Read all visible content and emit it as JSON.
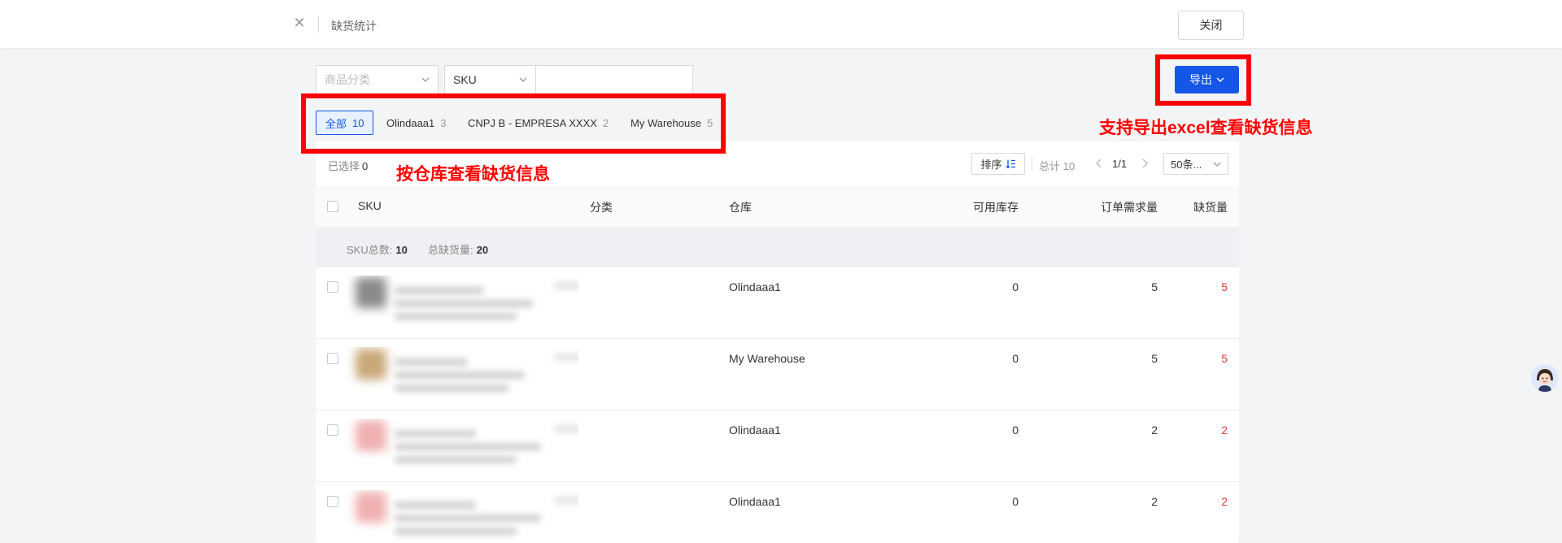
{
  "header": {
    "title": "缺货统计",
    "close_button": "关闭"
  },
  "filters": {
    "category_placeholder": "商品分类",
    "search_field": "SKU",
    "search_value": ""
  },
  "export_button": "导出",
  "annotations": {
    "export_note": "支持导出excel查看缺货信息",
    "tabs_note": "按仓库查看缺货信息"
  },
  "warehouse_tabs": [
    {
      "label": "全部",
      "count": "10",
      "active": true
    },
    {
      "label": "Olindaaa1",
      "count": "3"
    },
    {
      "label": "CNPJ B - EMPRESA XXXX",
      "count": "2"
    },
    {
      "label": "My Warehouse",
      "count": "5"
    }
  ],
  "toolbar": {
    "selected_label": "已选择",
    "selected_count": "0",
    "sort_label": "排序",
    "total_label": "总计 10",
    "page": "1/1",
    "page_size": "50条..."
  },
  "columns": {
    "sku": "SKU",
    "category": "分类",
    "warehouse": "仓库",
    "available_stock": "可用库存",
    "order_demand": "订单需求量",
    "shortage": "缺货量"
  },
  "summary": {
    "sku_total_label": "SKU总数:",
    "sku_total": "10",
    "shortage_total_label": "总缺货量:",
    "shortage_total": "20"
  },
  "rows": [
    {
      "warehouse": "Olindaaa1",
      "available": "0",
      "demand": "5",
      "shortage": "5",
      "thumb_color": "#8a8a8a"
    },
    {
      "warehouse": "My Warehouse",
      "available": "0",
      "demand": "5",
      "shortage": "5",
      "thumb_color": "#c9a877"
    },
    {
      "warehouse": "Olindaaa1",
      "available": "0",
      "demand": "2",
      "shortage": "2",
      "thumb_color": "#f0b0b0"
    },
    {
      "warehouse": "Olindaaa1",
      "available": "0",
      "demand": "2",
      "shortage": "2",
      "thumb_color": "#f0b0b0"
    }
  ],
  "colors": {
    "primary": "#1456e6",
    "shortage": "#e53935",
    "annotation": "#ff0000"
  }
}
